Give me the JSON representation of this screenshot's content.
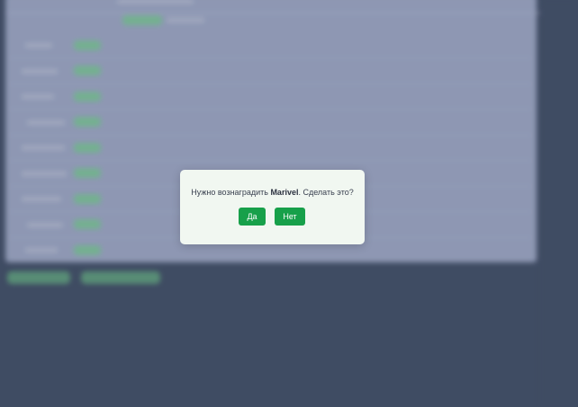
{
  "dialog": {
    "message_prefix": "Нужно вознаградить ",
    "message_name": "Marivel",
    "message_suffix": ". Сделать это?",
    "yes_label": "Да",
    "no_label": "Нет"
  },
  "colors": {
    "page_background": "#435067",
    "dialog_background": "#f1f7f1",
    "button_accent": "#17a04a"
  }
}
